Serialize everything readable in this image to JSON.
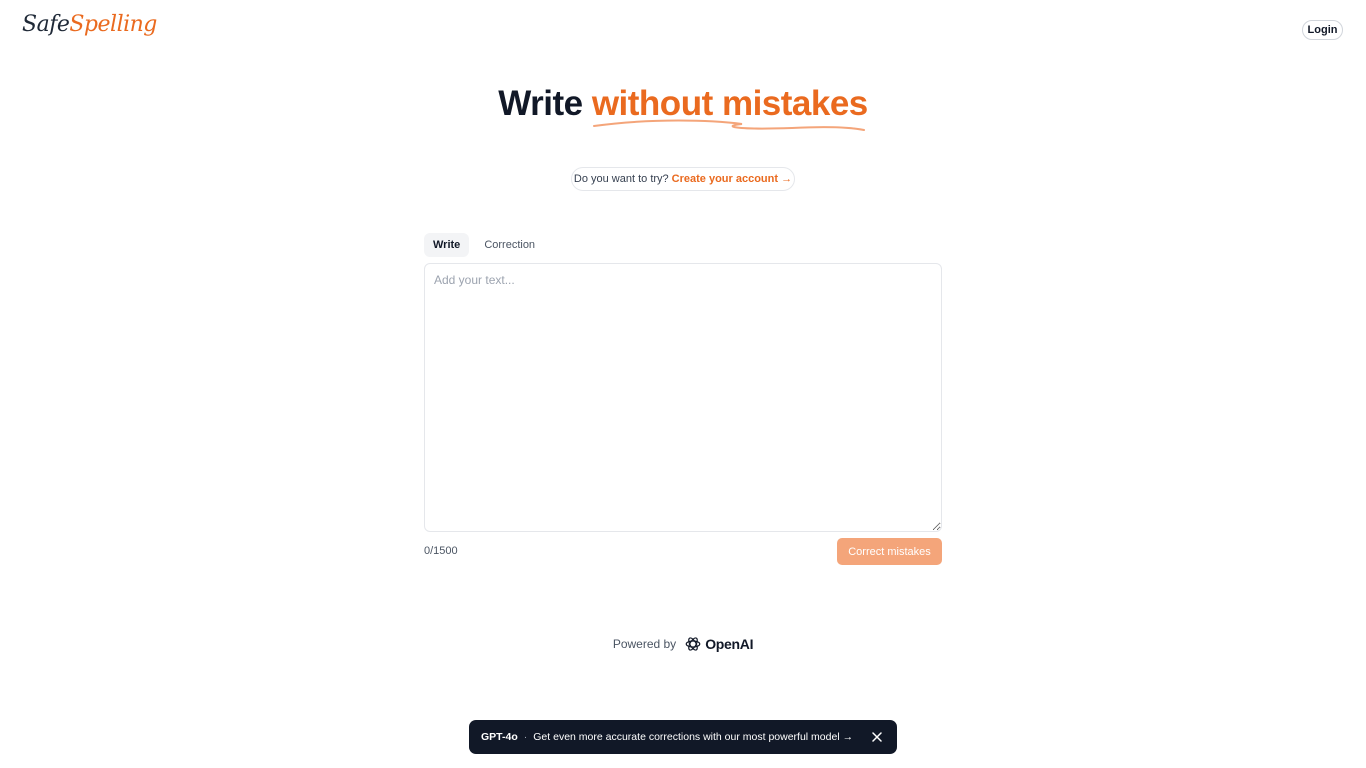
{
  "header": {
    "logo_part1": "Safe",
    "logo_part2": "Spelling",
    "login_label": "Login"
  },
  "hero": {
    "title_plain": "Write",
    "title_highlight": "without mistakes"
  },
  "cta": {
    "prompt": "Do you want to try?",
    "link": "Create your account →"
  },
  "tabs": [
    {
      "label": "Write",
      "active": true
    },
    {
      "label": "Correction",
      "active": false
    }
  ],
  "editor": {
    "placeholder": "Add your text...",
    "value": "",
    "counter": "0/1500",
    "submit_label": "Correct mistakes"
  },
  "footer": {
    "powered_by": "Powered by",
    "brand": "OpenAI",
    "brand_icon": "openai-logo-icon"
  },
  "banner": {
    "model": "GPT-4o",
    "separator": "·",
    "message": "Get even more accurate corrections with our most powerful model →",
    "close_icon": "close-icon"
  },
  "colors": {
    "accent": "#ea6a1f",
    "button_disabled": "#f4a57a",
    "banner_bg": "#111827"
  }
}
